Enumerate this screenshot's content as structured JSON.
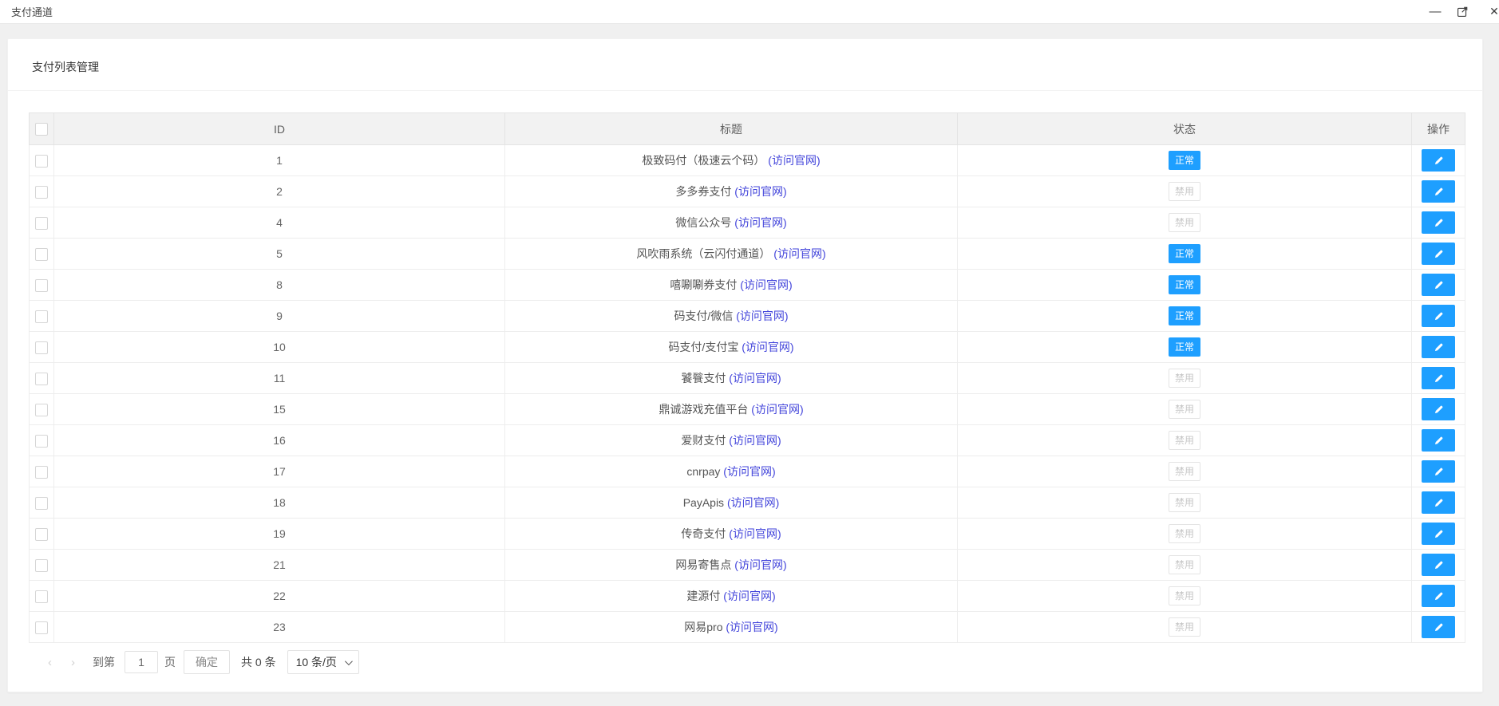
{
  "window": {
    "title": "支付通道",
    "minimize_glyph": "—",
    "close_glyph": "✕"
  },
  "page": {
    "card_title": "支付列表管理"
  },
  "table": {
    "headers": {
      "id": "ID",
      "title": "标题",
      "status": "状态",
      "action": "操作"
    },
    "link_label": "(访问官网)",
    "status_labels": {
      "normal": "正常",
      "disabled": "禁用"
    },
    "rows": [
      {
        "id": "1",
        "title": "极致码付（极速云个码）",
        "status": "normal"
      },
      {
        "id": "2",
        "title": "多多券支付",
        "status": "disabled"
      },
      {
        "id": "4",
        "title": "微信公众号",
        "status": "disabled"
      },
      {
        "id": "5",
        "title": "风吹雨系统（云闪付通道）",
        "status": "normal"
      },
      {
        "id": "8",
        "title": "嘻唰唰券支付",
        "status": "normal"
      },
      {
        "id": "9",
        "title": "码支付/微信",
        "status": "normal"
      },
      {
        "id": "10",
        "title": "码支付/支付宝",
        "status": "normal"
      },
      {
        "id": "11",
        "title": "饕餮支付",
        "status": "disabled"
      },
      {
        "id": "15",
        "title": "鼎诚游戏充值平台",
        "status": "disabled"
      },
      {
        "id": "16",
        "title": "爱财支付",
        "status": "disabled"
      },
      {
        "id": "17",
        "title": "cnrpay",
        "status": "disabled"
      },
      {
        "id": "18",
        "title": "PayApis",
        "status": "disabled"
      },
      {
        "id": "19",
        "title": "传奇支付",
        "status": "disabled"
      },
      {
        "id": "21",
        "title": "网易寄售点",
        "status": "disabled"
      },
      {
        "id": "22",
        "title": "建源付",
        "status": "disabled"
      },
      {
        "id": "23",
        "title": "网易pro",
        "status": "disabled"
      }
    ]
  },
  "pagination": {
    "prev_glyph": "‹",
    "next_glyph": "›",
    "goto_label": "到第",
    "page_value": "1",
    "page_unit": "页",
    "confirm_label": "确定",
    "total_label": "共 0 条",
    "per_page_value": "10 条/页"
  },
  "colors": {
    "primary": "#1E9FFF",
    "link": "#4345db",
    "page_background": "#f0f0f0",
    "header_background": "#f2f2f2"
  }
}
